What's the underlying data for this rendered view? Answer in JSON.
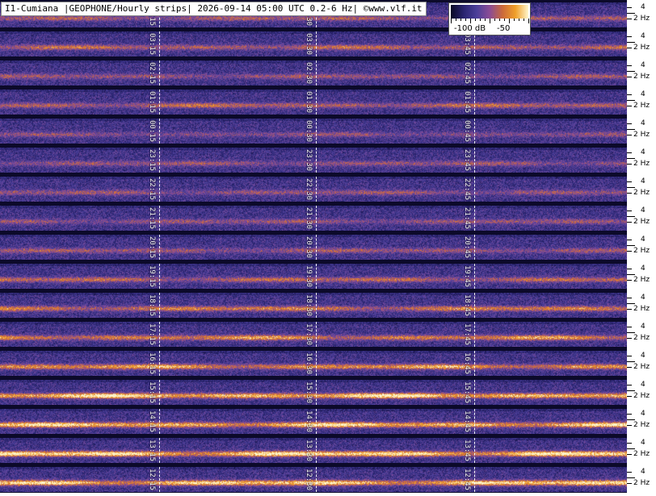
{
  "header": {
    "title": "I1-Cumiana |GEOPHONE/Hourly strips| 2026-09-14 05:00 UTC 0.2-6 Hz| ©www.vlf.it"
  },
  "colorbar": {
    "label_low": "-100 dB",
    "label_high": "-50",
    "colors": [
      "#0a0826",
      "#2a2470",
      "#4b3f9a",
      "#8a4c96",
      "#cc6a3a",
      "#f0a02a",
      "#fff6cc"
    ]
  },
  "frequency_axis": {
    "label_4": "4",
    "label_2": "2 Hz"
  },
  "strips": [
    {
      "markers": [
        "04:15",
        "04:30",
        "04:45"
      ],
      "intensity": 0.35
    },
    {
      "markers": [
        "03:15",
        "03:30",
        "03:45"
      ],
      "intensity": 0.4
    },
    {
      "markers": [
        "02:15",
        "02:30",
        "02:45"
      ],
      "intensity": 0.3
    },
    {
      "markers": [
        "01:15",
        "01:30",
        "01:45"
      ],
      "intensity": 0.4
    },
    {
      "markers": [
        "00:15",
        "00:30",
        "00:45"
      ],
      "intensity": 0.25
    },
    {
      "markers": [
        "23:15",
        "23:30",
        "23:45"
      ],
      "intensity": 0.3
    },
    {
      "markers": [
        "22:15",
        "22:30",
        "22:45"
      ],
      "intensity": 0.3
    },
    {
      "markers": [
        "21:15",
        "21:30",
        "21:45"
      ],
      "intensity": 0.3
    },
    {
      "markers": [
        "20:15",
        "20:30",
        "20:45"
      ],
      "intensity": 0.32
    },
    {
      "markers": [
        "19:15",
        "19:30",
        "19:45"
      ],
      "intensity": 0.42
    },
    {
      "markers": [
        "18:15",
        "18:30",
        "18:45"
      ],
      "intensity": 0.5
    },
    {
      "markers": [
        "17:15",
        "17:30",
        "17:45"
      ],
      "intensity": 0.55
    },
    {
      "markers": [
        "16:15",
        "16:30",
        "16:45"
      ],
      "intensity": 0.6
    },
    {
      "markers": [
        "15:15",
        "15:30",
        "15:45"
      ],
      "intensity": 0.8
    },
    {
      "markers": [
        "14:15",
        "14:30",
        "14:45"
      ],
      "intensity": 0.75
    },
    {
      "markers": [
        "13:15",
        "13:30",
        "13:45"
      ],
      "intensity": 0.85
    },
    {
      "markers": [
        "12:15",
        "12:30",
        "12:45"
      ],
      "intensity": 0.78
    }
  ]
}
